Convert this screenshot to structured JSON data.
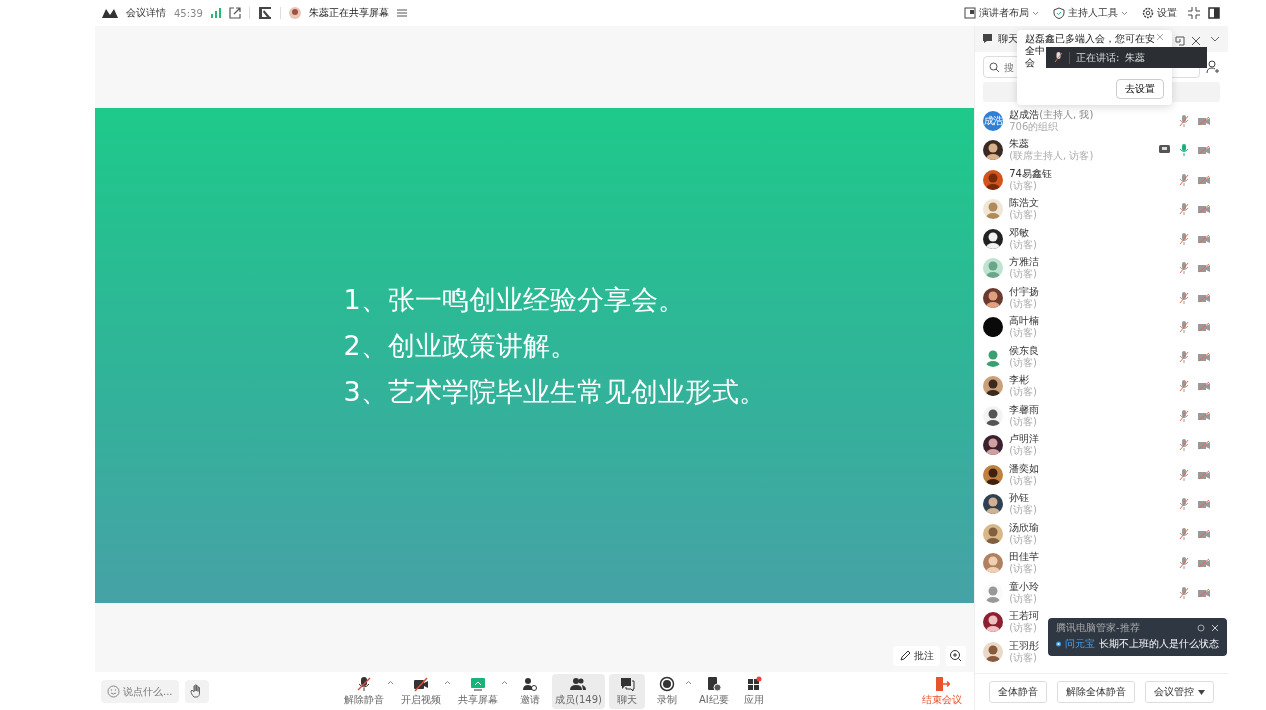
{
  "top_bar": {
    "meeting_info": "会议详情",
    "duration": "45:39",
    "sharing_status": "朱蕊正在共享屏幕",
    "right_items": [
      {
        "label": "演讲者布局",
        "kind": "layout"
      },
      {
        "label": "主持人工具",
        "kind": "host"
      },
      {
        "label": "设置",
        "kind": "settings"
      }
    ]
  },
  "slide": {
    "lines": [
      "1、张一鸣创业经验分享会。",
      "2、创业政策讲解。",
      "3、艺术学院毕业生常见创业形式。"
    ]
  },
  "annotate_button": "批注",
  "toolbar": {
    "chat_placeholder": "说点什么...",
    "buttons": [
      {
        "label": "解除静音",
        "kind": "mic",
        "caret": true,
        "selected": false
      },
      {
        "label": "开启视频",
        "kind": "video",
        "caret": true,
        "selected": false
      },
      {
        "label": "共享屏幕",
        "kind": "share",
        "caret": true,
        "selected": false
      },
      {
        "label": "邀请",
        "kind": "invite",
        "caret": false,
        "selected": false
      },
      {
        "label": "成员(149)",
        "kind": "members",
        "caret": false,
        "selected": true
      },
      {
        "label": "聊天",
        "kind": "chat",
        "caret": false,
        "selected": true
      },
      {
        "label": "录制",
        "kind": "record",
        "caret": true,
        "selected": false
      },
      {
        "label": "AI纪要",
        "kind": "ai",
        "caret": false,
        "selected": false
      },
      {
        "label": "应用",
        "kind": "apps",
        "caret": false,
        "selected": false
      }
    ],
    "end_button": "结束会议"
  },
  "side_panel": {
    "tab": "聊天",
    "search_placeholder": "搜",
    "participants": [
      {
        "name": "赵成浩",
        "role": "(主持人, 我)",
        "subtitle": "706的组织",
        "avatar_text": "成浩",
        "mic_on": false,
        "sharing": false
      },
      {
        "name": "朱蕊",
        "subtitle": "(联席主持人, 访客)",
        "mic_on": true,
        "sharing": true
      },
      {
        "name": "74易鑫钰",
        "subtitle": "(访客)",
        "mic_on": false,
        "sharing": false
      },
      {
        "name": "陈浩文",
        "subtitle": "(访客)",
        "mic_on": false,
        "sharing": false
      },
      {
        "name": "邓敏",
        "subtitle": "(访客)",
        "mic_on": false,
        "sharing": false
      },
      {
        "name": "方雅洁",
        "subtitle": "(访客)",
        "mic_on": false,
        "sharing": false
      },
      {
        "name": "付宇扬",
        "subtitle": "(访客)",
        "mic_on": false,
        "sharing": false
      },
      {
        "name": "高叶楠",
        "subtitle": "(访客)",
        "mic_on": false,
        "sharing": false
      },
      {
        "name": "侯东良",
        "subtitle": "(访客)",
        "mic_on": false,
        "sharing": false
      },
      {
        "name": "李彬",
        "subtitle": "(访客)",
        "mic_on": false,
        "sharing": false
      },
      {
        "name": "李馨雨",
        "subtitle": "(访客)",
        "mic_on": false,
        "sharing": false
      },
      {
        "name": "卢明洋",
        "subtitle": "(访客)",
        "mic_on": false,
        "sharing": false
      },
      {
        "name": "潘奕如",
        "subtitle": "(访客)",
        "mic_on": false,
        "sharing": false
      },
      {
        "name": "孙钰",
        "subtitle": "(访客)",
        "mic_on": false,
        "sharing": false
      },
      {
        "name": "汤欣瑜",
        "subtitle": "(访客)",
        "mic_on": false,
        "sharing": false
      },
      {
        "name": "田佳芊",
        "subtitle": "(访客)",
        "mic_on": false,
        "sharing": false
      },
      {
        "name": "童小玲",
        "subtitle": "(访客)",
        "mic_on": false,
        "sharing": false
      },
      {
        "name": "王若珂",
        "subtitle": "(访客)"
      },
      {
        "name": "王羽彤",
        "subtitle": "(访客)"
      }
    ],
    "bottom_buttons": [
      {
        "label": "全体静音",
        "caret": false
      },
      {
        "label": "解除全体静音",
        "caret": false
      },
      {
        "label": "会议管控",
        "caret": true
      }
    ]
  },
  "notice": {
    "lines": [
      "赵磊鑫已多端入会，您可在安",
      "全中",
      "会"
    ],
    "button": "去设置"
  },
  "speaking_toast": {
    "label": "正在讲话:",
    "name": "朱蕊"
  },
  "promo_toast": {
    "source": "腾讯电脑管家-推荐",
    "app": "问元宝",
    "text": "长期不上班的人是什么状态"
  }
}
